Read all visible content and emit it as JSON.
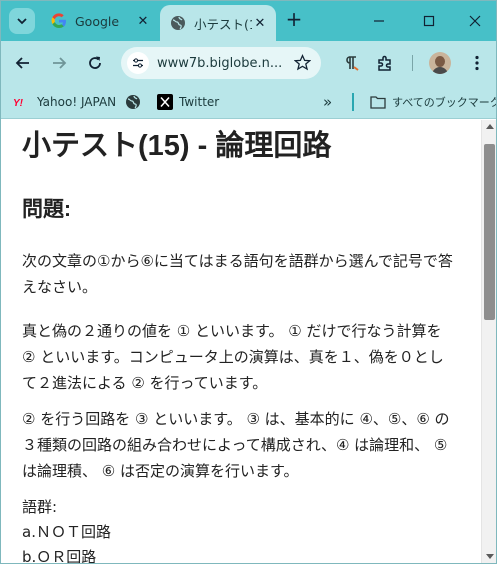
{
  "browser": {
    "tabs": [
      {
        "title": "Google",
        "icon": "google-g-icon",
        "active": false
      },
      {
        "title": "小テスト(1",
        "icon": "globe-icon",
        "active": true
      }
    ],
    "address": {
      "url": "www7b.biglobe.n..."
    },
    "bookmarks": [
      {
        "label": "Yahoo! JAPAN",
        "icon": "yahoo-japan-icon"
      },
      {
        "label": "",
        "icon": "globe-icon"
      },
      {
        "label": "Twitter",
        "icon": "x-twitter-icon"
      }
    ],
    "bookmarks_overflow": "»",
    "all_bookmarks_label": "すべてのブックマーク",
    "colors": {
      "tab_strip": "#47c0c8",
      "toolbar": "#b9e6e9",
      "omnibox": "#e6f6f7"
    }
  },
  "page": {
    "title": "小テスト(15) - 論理回路",
    "section_heading": "問題:",
    "paragraphs": [
      "次の文章の①から⑥に当てはまる語句を語群から選んで記号で答えなさい。",
      "真と偽の２通りの値を ① といいます。 ① だけで行なう計算を ② といいます。コンピュータ上の演算は、真を１、偽を０として２進法による ② を行っています。",
      "② を行う回路を ③ といいます。 ③ は、基本的に ④、⑤、⑥ の３種類の回路の組み合わせによって構成され、④ は論理和、 ⑤ は論理積、 ⑥ は否定の演算を行います。"
    ],
    "word_group_label": "語群:",
    "word_group": [
      "a.ＮＯＴ回路",
      "b.ＯＲ回路"
    ]
  }
}
